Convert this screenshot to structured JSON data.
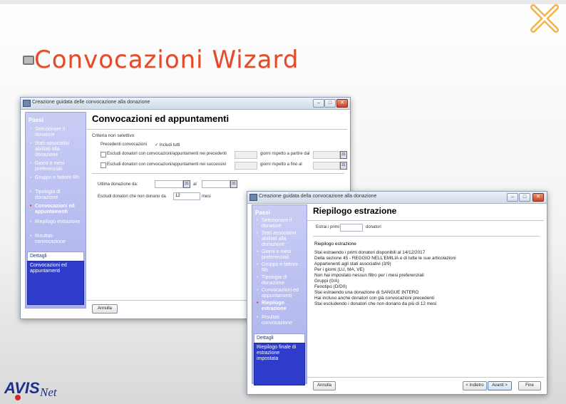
{
  "slide": {
    "title": "Convocazioni Wizard",
    "logo_text": "AVIS",
    "logo_suffix": "Net"
  },
  "win1": {
    "titlebar": "Creazione guidata delle convocazione alla donazione",
    "sidebar": {
      "header": "Passi",
      "steps": [
        "Selezionare il donatore",
        "Stati associativi abilitati alla donazione",
        "Giorni e mesi preferenziali",
        "Gruppo e fattore Rh",
        "Tipologia di donazione",
        "Convocazioni ed appuntamenti",
        "Riepilogo estrazione",
        "Risultati convocazione"
      ],
      "active_index": 5,
      "details_label": "Dettagli",
      "details_text": "Convocazioni ed appuntamenti"
    },
    "main": {
      "heading": "Convocazioni ed appuntamenti",
      "criteria_label": "Criteria non selettivo",
      "previous_label": "Precedenti convocazioni",
      "include_all": "✓ Includi tutti",
      "excl_conv": "Escludi donatori con convocazioni/appuntamenti nei precedenti",
      "excl_conv_days": "giorni rispetto a partire dal",
      "excl_fut": "Escludi donatori con convocazioni/appuntamenti nei successivi",
      "excl_fut_days": "giorni rispetto a fino al",
      "last_donation": "Ultima donazione da:",
      "to_label": "al",
      "exclude_months": "Escludi donatori che non donano da",
      "months_value": "12",
      "months_unit": "mesi",
      "cancel": "Annulla"
    }
  },
  "win2": {
    "titlebar": "Creazione guidata della convocazione alla donazione",
    "sidebar": {
      "header": "Passi",
      "steps": [
        "Selezionare il donatore",
        "Stati associativi abilitati alla donazione",
        "Giorni e mesi preferenziali",
        "Gruppo e fattore Rh",
        "Tipologia di donazione",
        "Convocazioni ed appuntamenti",
        "Riepilogo estrazione",
        "Risultati convocazione"
      ],
      "active_index": 6,
      "details_label": "Dettagli",
      "details_text": "Riepilogo finale di estrazione impostata"
    },
    "main": {
      "heading": "Riepilogo estrazione",
      "first_label": "Estrai i primi",
      "donors_label": "donatori",
      "summary_title": "Riepilogo estrazione",
      "lines": [
        "Stai estraendo i primi donatori disponibili al 14/12/2017",
        "Della sezione 45 - REGGIO NELL'EMILIA e di tutte le sue articolazioni",
        "Appartenenti agli stati associativi (3/9)",
        "Per i giorni (LU, MA, VE)",
        "Non hai impostato nessun filtro per i mesi preferenziali",
        "Gruppi (0/A)",
        "Fenotipo (D/D0)",
        "Stai estraendo una donazione di SANGUE INTERO",
        "Hai incluso anche donatori con già convocazioni precedenti",
        "Stai escludendo i donatori che non donano da più di 12 mesi"
      ],
      "cancel": "Annulla",
      "back": "< Indietro",
      "next": "Avanti >",
      "finish": "Fine"
    }
  },
  "colors": {
    "title": "#e44b2a",
    "sidebar": "#aab0ec",
    "details_box": "#2e3ccc"
  }
}
